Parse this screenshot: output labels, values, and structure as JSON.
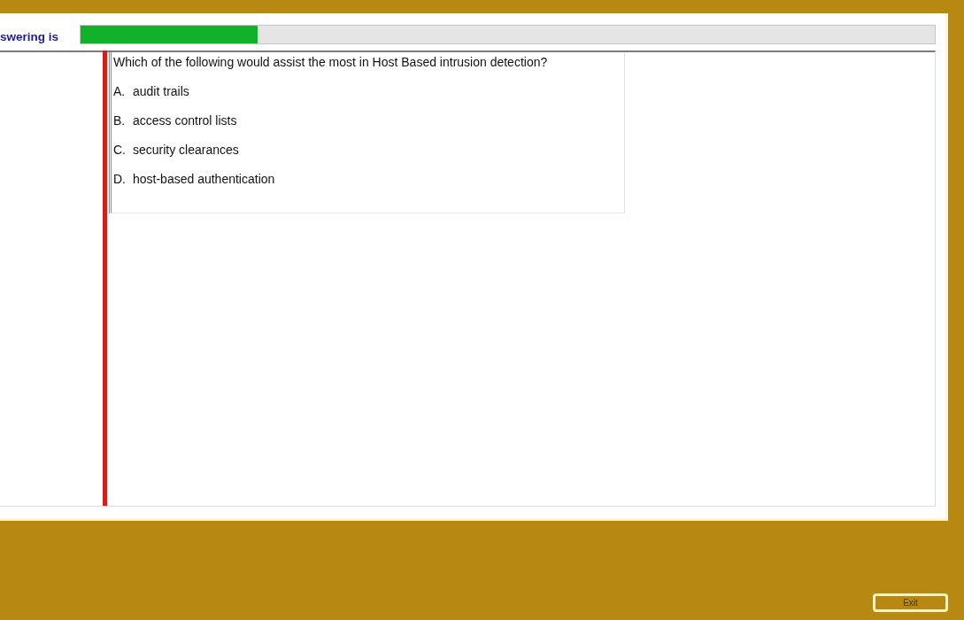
{
  "header": {
    "label": "swering is"
  },
  "progress": {
    "level": 0.207
  },
  "question": {
    "text": "Which of the following would assist the most in Host Based intrusion detection?",
    "options": [
      {
        "letter": "A.",
        "text": "audit trails"
      },
      {
        "letter": "B.",
        "text": "access control lists"
      },
      {
        "letter": "C.",
        "text": "security clearances"
      },
      {
        "letter": "D.",
        "text": "host-based authentication"
      }
    ]
  },
  "buttons": [
    {
      "label": "Exit"
    }
  ]
}
